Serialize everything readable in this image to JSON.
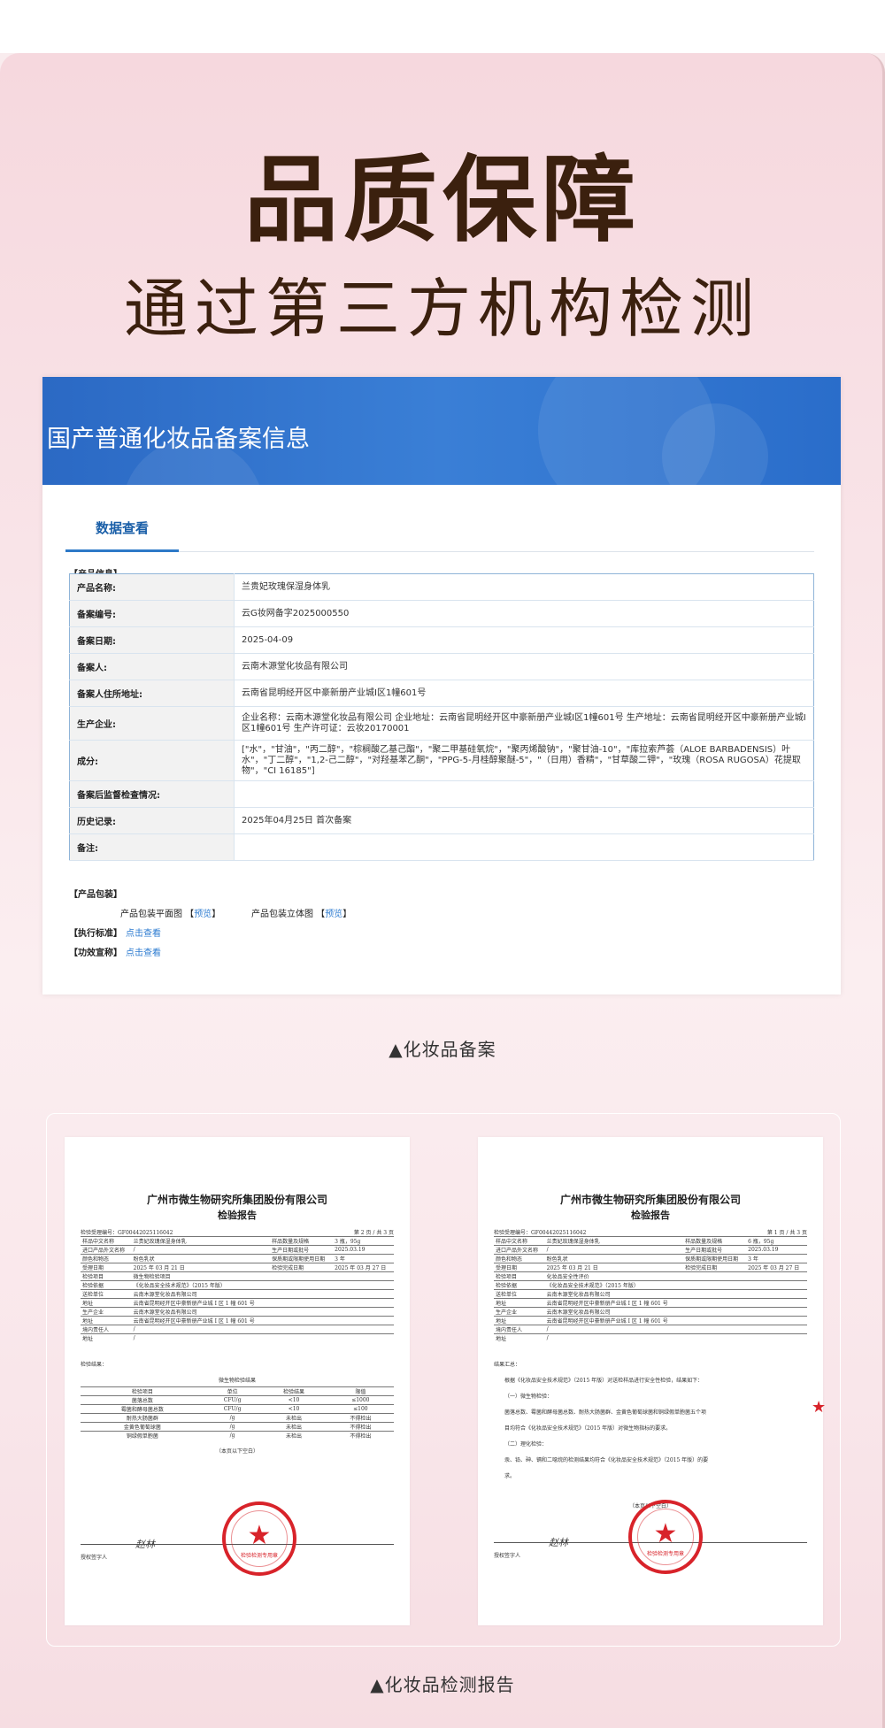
{
  "hero": {
    "title": "品质保障",
    "subtitle": "通过第三方机构检测"
  },
  "registration": {
    "banner_title": "国产普通化妆品备案信息",
    "tab_label": "数据查看",
    "product_info_label": "【产品信息】",
    "rows": [
      {
        "key": "产品名称:",
        "value": "兰贵妃玫瑰保湿身体乳"
      },
      {
        "key": "备案编号:",
        "value": "云G妆网备字2025000550"
      },
      {
        "key": "备案日期:",
        "value": "2025-04-09"
      },
      {
        "key": "备案人:",
        "value": "云南木源堂化妆品有限公司"
      },
      {
        "key": "备案人住所地址:",
        "value": "云南省昆明经开区中豪新册产业城I区1幢601号"
      },
      {
        "key": "生产企业:",
        "value": "企业名称：云南木源堂化妆品有限公司 企业地址：云南省昆明经开区中豪新册产业城I区1幢601号 生产地址：云南省昆明经开区中豪新册产业城I区1幢601号 生产许可证：云妆20170001"
      },
      {
        "key": "成分:",
        "value": "[\"水\"，\"甘油\"，\"丙二醇\"，\"棕榈酸乙基己酯\"，\"聚二甲基硅氧烷\"，\"聚丙烯酸钠\"，\"聚甘油-10\"，\"库拉索芦荟（ALOE BARBADENSIS）叶水\"，\"丁二醇\"，\"1,2-己二醇\"，\"对羟基苯乙酮\"，\"PPG-5-月桂醇聚醚-5\"，\"（日用）香精\"，\"甘草酸二钾\"，\"玫瑰（ROSA RUGOSA）花提取物\"，\"CI 16185\"]"
      },
      {
        "key": "备案后监督检查情况:",
        "value": ""
      },
      {
        "key": "历史记录:",
        "value": "2025年04月25日 首次备案"
      },
      {
        "key": "备注:",
        "value": ""
      }
    ],
    "package_label": "【产品包装】",
    "pack_flat_label": "产品包装平面图",
    "pack_3d_label": "产品包装立体图",
    "preview_link": "预览",
    "standard_label": "【执行标准】",
    "efficacy_label": "【功效宣称】",
    "view_link": "点击查看"
  },
  "caption_registration": "▲化妆品备案",
  "caption_report": "▲化妆品检测报告",
  "reports": [
    {
      "org": "广州市微生物研究所集团股份有限公司",
      "title": "检验报告",
      "number": "检验受理编号：GF00442025116042",
      "page": "第 2 页 / 共 3 页",
      "rows": [
        [
          "样品中文名称",
          "兰贵妃玫瑰保湿身体乳",
          "样品数量及规格",
          "3 瓶，95g"
        ],
        [
          "进口产品外文名称",
          "/",
          "生产日期或批号",
          "2025.03.19"
        ],
        [
          "颜色和物态",
          "粉色乳状",
          "保质期或限期使用日期",
          "3 年"
        ],
        [
          "受理日期",
          "2025 年 03 月 21 日",
          "检验完成日期",
          "2025 年 03 月 27 日"
        ],
        [
          "检验项目",
          "微生物检验项目",
          "",
          ""
        ],
        [
          "检验依据",
          "《化妆品安全技术规范》（2015 年版）",
          "",
          ""
        ],
        [
          "送检单位",
          "云南木源堂化妆品有限公司",
          "",
          ""
        ],
        [
          "地址",
          "云南省昆明经开区中豪新册产业城 I 区 1 幢 601 号",
          "",
          ""
        ],
        [
          "生产企业",
          "云南木源堂化妆品有限公司",
          "",
          ""
        ],
        [
          "地址",
          "云南省昆明经开区中豪新册产业城 I 区 1 幢 601 号",
          "",
          ""
        ],
        [
          "境内责任人",
          "/",
          "",
          ""
        ],
        [
          "地址",
          "/",
          "",
          ""
        ]
      ],
      "result_label": "检验结果：",
      "micro_title": "微生物检验结果",
      "micro_head": [
        "检验项目",
        "单位",
        "检验结果",
        "限值"
      ],
      "micro_rows": [
        [
          "菌落总数",
          "CFU/g",
          "<10",
          "≤1000"
        ],
        [
          "霉菌和酵母菌总数",
          "CFU/g",
          "<10",
          "≤100"
        ],
        [
          "耐热大肠菌群",
          "/g",
          "未检出",
          "不得检出"
        ],
        [
          "金黄色葡萄球菌",
          "/g",
          "未检出",
          "不得检出"
        ],
        [
          "铜绿假单胞菌",
          "/g",
          "未检出",
          "不得检出"
        ]
      ],
      "end_note": "（本页以下空白）",
      "signer_label": "授权签字人",
      "signature": "赵林",
      "seal_text": "检验检测专用章"
    },
    {
      "org": "广州市微生物研究所集团股份有限公司",
      "title": "检验报告",
      "number": "检验受理编号：GF00442025116042",
      "page": "第 1 页 / 共 3 页",
      "rows": [
        [
          "样品中文名称",
          "兰贵妃玫瑰保湿身体乳",
          "样品数量及规格",
          "6 瓶，95g"
        ],
        [
          "进口产品外文名称",
          "/",
          "生产日期或批号",
          "2025.03.19"
        ],
        [
          "颜色和物态",
          "粉色乳状",
          "保质期或限期使用日期",
          "3 年"
        ],
        [
          "受理日期",
          "2025 年 03 月 21 日",
          "检验完成日期",
          "2025 年 03 月 27 日"
        ],
        [
          "检验项目",
          "化妆品安全性评价",
          "",
          ""
        ],
        [
          "检验依据",
          "《化妆品安全技术规范》（2015 年版）",
          "",
          ""
        ],
        [
          "送检单位",
          "云南木源堂化妆品有限公司",
          "",
          ""
        ],
        [
          "地址",
          "云南省昆明经开区中豪新册产业城 I 区 1 幢 601 号",
          "",
          ""
        ],
        [
          "生产企业",
          "云南木源堂化妆品有限公司",
          "",
          ""
        ],
        [
          "地址",
          "云南省昆明经开区中豪新册产业城 I 区 1 幢 601 号",
          "",
          ""
        ],
        [
          "境内责任人",
          "/",
          "",
          ""
        ],
        [
          "地址",
          "/",
          "",
          ""
        ]
      ],
      "summary_label": "结果汇总：",
      "summary_lines": [
        "根据《化妆品安全技术规范》（2015 年版）对送检样品进行安全性检验，结果如下：",
        "（一）微生物检验：",
        "菌落总数、霉菌和酵母菌总数、耐热大肠菌群、金黄色葡萄球菌和铜绿假单胞菌五个项",
        "目均符合《化妆品安全技术规范》（2015 年版）对微生物指标的要求。",
        "（二）理化检验：",
        "汞、铅、砷、镉和二噁烷的检测结果均符合《化妆品安全技术规范》（2015 年版）的要",
        "求。"
      ],
      "end_note": "（本页以下空白）",
      "signer_label": "授权签字人",
      "signature": "赵林",
      "seal_text": "检验检测专用章"
    }
  ],
  "colors": {
    "brand_dark": "#3b200e",
    "banner_blue": "#2b69c4",
    "link_blue": "#2c7bd0",
    "seal_red": "#d8232a"
  }
}
